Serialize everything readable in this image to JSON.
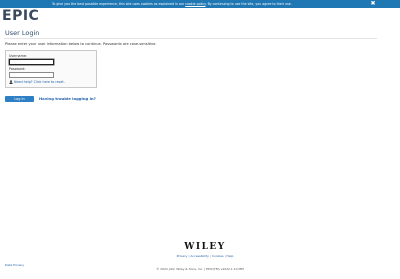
{
  "cookie_bar": {
    "message_before": "To give you the best possible experience, this site uses cookies as explained in our",
    "link": "cookie policy",
    "message_after": ". By continuing to use the site, you agree to their use.",
    "close": "✖"
  },
  "header": {
    "logo": "EPIC"
  },
  "login": {
    "title": "User Login",
    "instructions": "Please enter your user information below to continue. Passwords are case-sensitive.",
    "username_label": "Username:",
    "username_value": "",
    "password_label": "Password:",
    "password_value": "",
    "reset_text": "Need help? Click here to reset.",
    "button": "Log In",
    "trouble_link": "Having trouble logging in?"
  },
  "footer": {
    "brand": "WILEY",
    "links": [
      "Privacy",
      "Accessibility",
      "Cookies",
      "Help"
    ],
    "data_privacy": "Data Privacy",
    "copyright": "© 2022 John Wiley & Sons, Inc.  |  EPIC(TM) v2022.1.10 MM"
  },
  "colors": {
    "cookie_bar": "#1f78b4",
    "primary_button": "#2f7fc4",
    "link": "#1f5fa8"
  }
}
